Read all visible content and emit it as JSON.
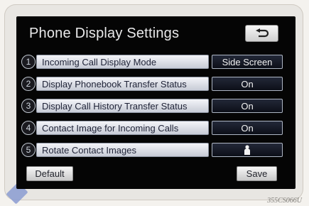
{
  "header": {
    "title": "Phone Display Settings",
    "back_icon": "return-arrow-icon"
  },
  "settings": [
    {
      "number": "1",
      "label": "Incoming Call Display Mode",
      "value": "Side Screen"
    },
    {
      "number": "2",
      "label": "Display Phonebook Transfer Status",
      "value": "On"
    },
    {
      "number": "3",
      "label": "Display Call History Transfer Status",
      "value": "On"
    },
    {
      "number": "4",
      "label": "Contact Image for Incoming Calls",
      "value": "On"
    },
    {
      "number": "5",
      "label": "Rotate Contact Images",
      "value_icon": "person-icon"
    }
  ],
  "footer": {
    "default_label": "Default",
    "save_label": "Save"
  },
  "image_code": "355CS066U"
}
